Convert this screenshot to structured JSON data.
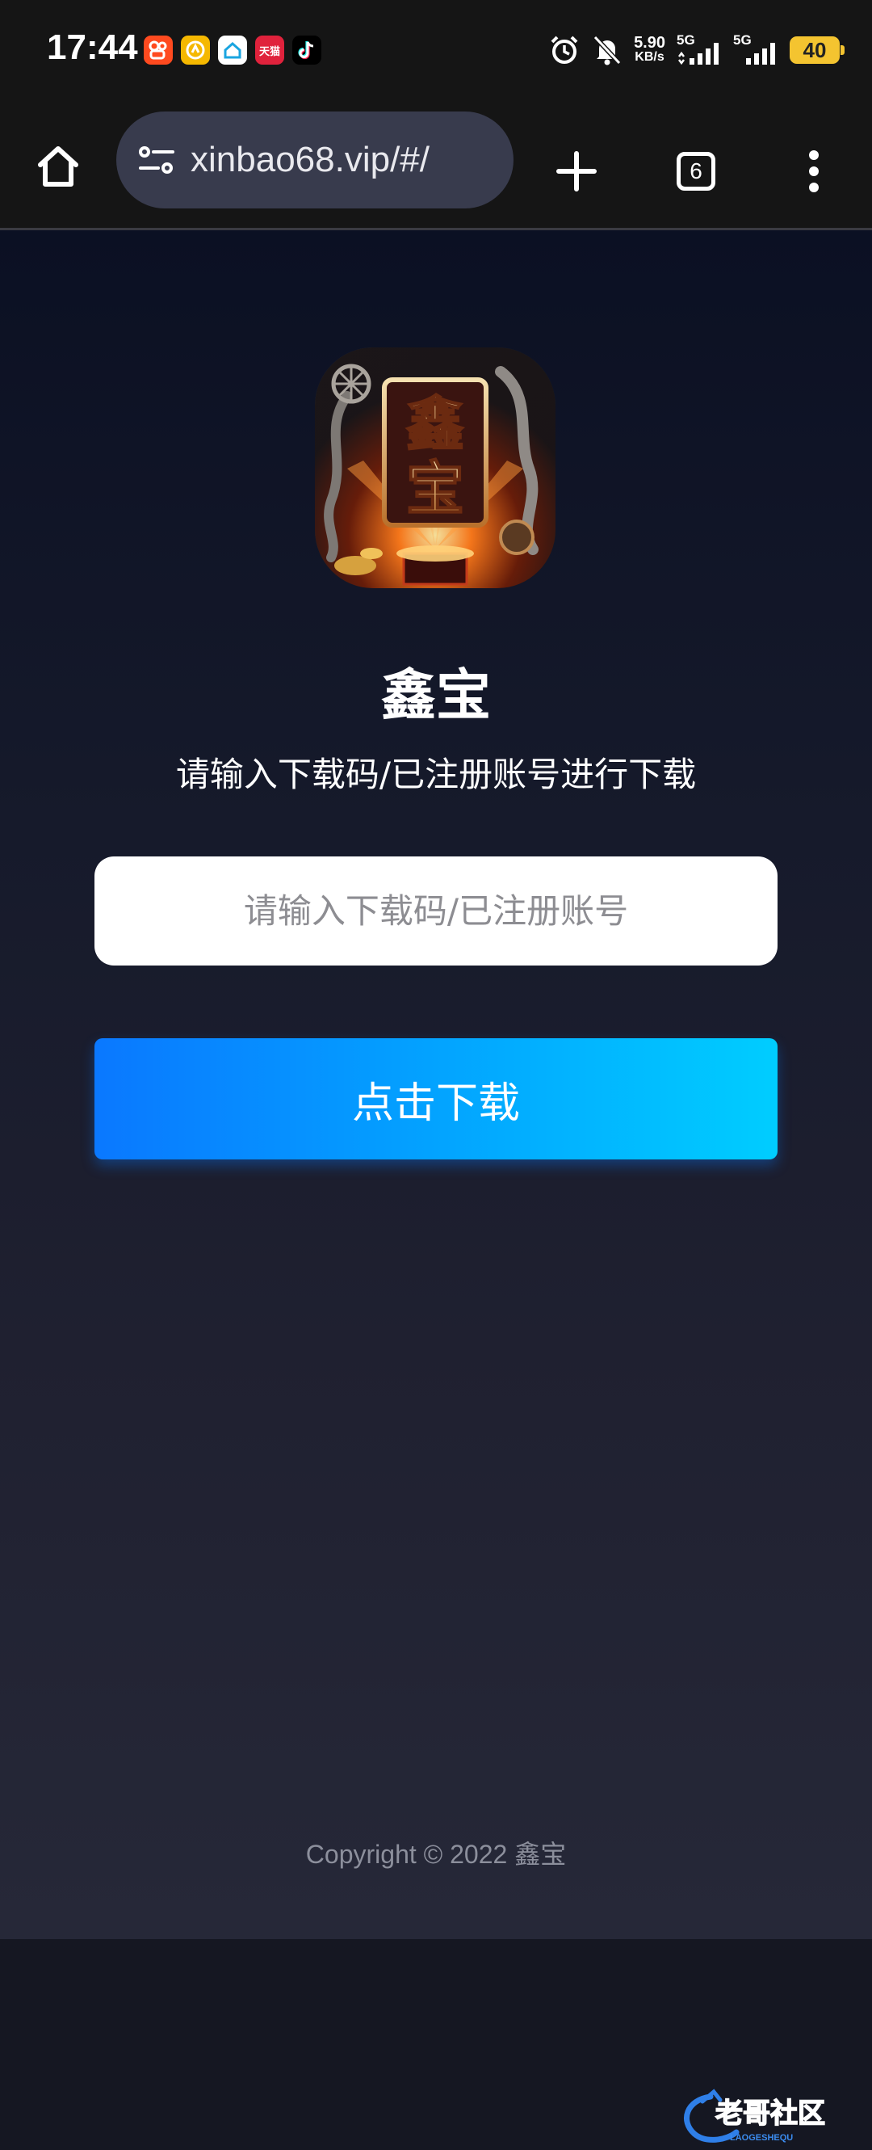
{
  "status_bar": {
    "time": "17:44",
    "notification_icons": [
      "kuaishou-icon",
      "hand-app-icon",
      "home-app-icon",
      "tmall-icon",
      "tiktok-icon"
    ],
    "tmall_label": "天猫",
    "network_speed": {
      "value": "5.90",
      "unit": "KB/s"
    },
    "signal_1_label": "5G",
    "signal_2_label": "5G",
    "battery": "40",
    "battery_color": "#f4c430"
  },
  "browser": {
    "url": "xinbao68.vip/#/",
    "tab_count": "6"
  },
  "page": {
    "app_name": "鑫宝",
    "subtitle": "请输入下载码/已注册账号进行下载",
    "input_placeholder": "请输入下载码/已注册账号",
    "input_value": "",
    "download_button": "点击下载",
    "button_gradient": [
      "#0a78ff",
      "#00cdff"
    ],
    "copyright": "Copyright © 2022 鑫宝"
  },
  "watermark": {
    "text": "老哥社区",
    "subtext": "LAOGESHEQU"
  }
}
